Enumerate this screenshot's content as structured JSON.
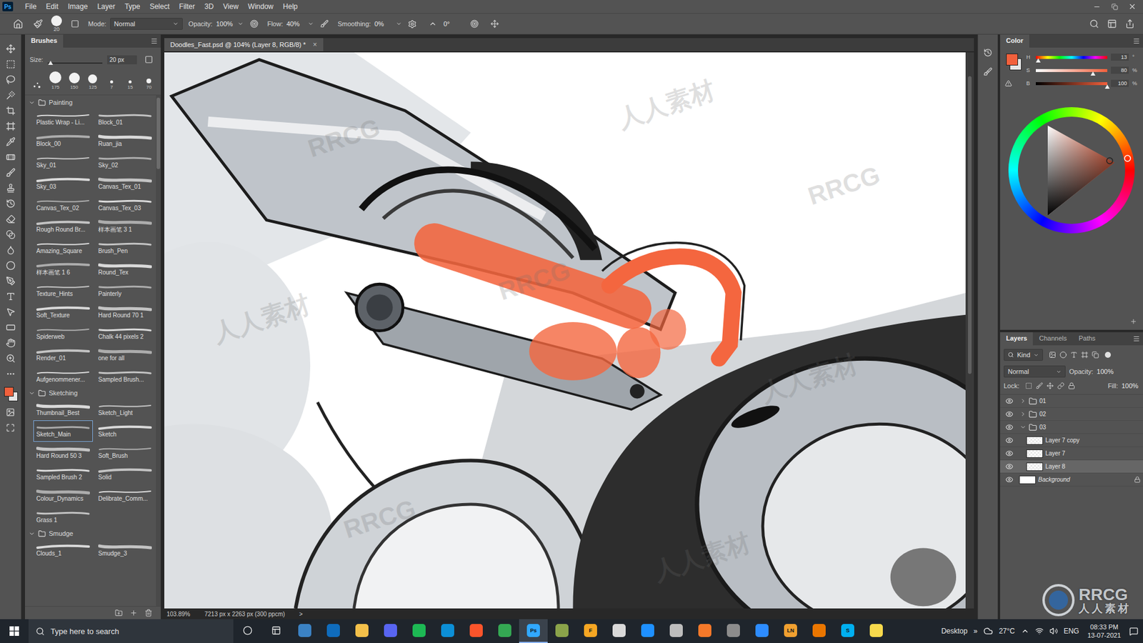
{
  "menu": {
    "logo": "Ps",
    "items": [
      "File",
      "Edit",
      "Image",
      "Layer",
      "Type",
      "Select",
      "Filter",
      "3D",
      "View",
      "Window",
      "Help"
    ]
  },
  "options_bar": {
    "brush_size": "20",
    "mode_label": "Mode:",
    "mode": "Normal",
    "opacity_label": "Opacity:",
    "opacity": "100%",
    "flow_label": "Flow:",
    "flow": "40%",
    "smoothing_label": "Smoothing:",
    "smoothing": "0%",
    "angle": "0°"
  },
  "tabs": [
    {
      "label": "Doodles_Fast.psd @ 104% (Layer 8, RGB/8) *",
      "selected": true,
      "close": "×"
    }
  ],
  "brushes_panel": {
    "title": "Brushes",
    "size_label": "Size:",
    "size": "20 px",
    "size_level": 0.05,
    "presets": [
      "175",
      "150",
      "125",
      "7",
      "15",
      "70"
    ],
    "groups": [
      {
        "name": "Painting",
        "expanded": true,
        "items": [
          {
            "label": "Plastic Wrap - Li...",
            "selected": false
          },
          {
            "label": "Block_01",
            "selected": false
          },
          {
            "label": "Block_00",
            "selected": false
          },
          {
            "label": "Ruan_jia",
            "selected": false
          },
          {
            "label": "Sky_01",
            "selected": false
          },
          {
            "label": "Sky_02",
            "selected": false
          },
          {
            "label": "Sky_03",
            "selected": false
          },
          {
            "label": "Canvas_Tex_01",
            "selected": false
          },
          {
            "label": "Canvas_Tex_02",
            "selected": false
          },
          {
            "label": "Canvas_Tex_03",
            "selected": false
          },
          {
            "label": "Rough Round Br...",
            "selected": false
          },
          {
            "label": "样本画笔 3 1",
            "selected": false
          },
          {
            "label": "Amazing_Square",
            "selected": false
          },
          {
            "label": "Brush_Pen",
            "selected": false
          },
          {
            "label": "样本画笔 1 6",
            "selected": false
          },
          {
            "label": "Round_Tex",
            "selected": false
          },
          {
            "label": "Texture_Hints",
            "selected": false
          },
          {
            "label": "Painterly",
            "selected": false
          },
          {
            "label": "Soft_Texture",
            "selected": false
          },
          {
            "label": "Hard Round 70 1",
            "selected": false
          },
          {
            "label": "Spiderweb",
            "selected": false
          },
          {
            "label": "Chalk 44 pixels 2",
            "selected": false
          },
          {
            "label": "Render_01",
            "selected": false
          },
          {
            "label": "one for all",
            "selected": false
          },
          {
            "label": "Aufgenommener...",
            "selected": false
          },
          {
            "label": "Sampled Brush...",
            "selected": false
          }
        ]
      },
      {
        "name": "Sketching",
        "expanded": true,
        "items": [
          {
            "label": "Thumbnail_Best",
            "selected": false
          },
          {
            "label": "Sketch_Light",
            "selected": false
          },
          {
            "label": "Sketch_Main",
            "selected": true
          },
          {
            "label": "Sketch",
            "selected": false
          },
          {
            "label": "Hard Round 50 3",
            "selected": false
          },
          {
            "label": "Soft_Brush",
            "selected": false
          },
          {
            "label": "Sampled Brush 2",
            "selected": false
          },
          {
            "label": "Solid",
            "selected": false
          },
          {
            "label": "Colour_Dynamics",
            "selected": false
          },
          {
            "label": "Delibrate_Comm...",
            "selected": false
          },
          {
            "label": "Grass 1",
            "selected": false
          }
        ]
      },
      {
        "name": "Smudge",
        "expanded": true,
        "items": [
          {
            "label": "Clouds_1",
            "selected": false
          },
          {
            "label": "Smudge_3",
            "selected": false
          }
        ]
      }
    ]
  },
  "status_bar": {
    "zoom": "103.89%",
    "info": "7213 px x 2263 px (300 ppcm)",
    "arrow": ">"
  },
  "color_panel": {
    "title": "Color",
    "foreground": "#f2603c",
    "background": "#e6e6e6",
    "channels": [
      {
        "name": "H",
        "kind": "hue",
        "value": "13",
        "unit": "°",
        "level": 0.036
      },
      {
        "name": "S",
        "kind": "saturation",
        "value": "80",
        "unit": "%",
        "level": 0.8
      },
      {
        "name": "B",
        "kind": "brightness",
        "value": "100",
        "unit": "%",
        "level": 1
      }
    ]
  },
  "layers_panel": {
    "tabs": [
      {
        "label": "Layers",
        "selected": true
      },
      {
        "label": "Channels",
        "selected": false
      },
      {
        "label": "Paths",
        "selected": false
      }
    ],
    "filter": "Kind",
    "blend_mode": "Normal",
    "opacity_label": "Opacity:",
    "opacity": "100%",
    "lock_label": "Lock:",
    "fill_label": "Fill:",
    "fill": "100%",
    "layers": [
      {
        "name": "01",
        "kind": "group",
        "visible": true,
        "expanded": false,
        "selected": false,
        "locked": false,
        "children": []
      },
      {
        "name": "02",
        "kind": "group",
        "visible": true,
        "expanded": false,
        "selected": false,
        "locked": false,
        "children": []
      },
      {
        "name": "03",
        "kind": "group",
        "visible": true,
        "expanded": true,
        "selected": false,
        "locked": false,
        "children": [
          {
            "name": "Layer 7 copy",
            "kind": "layer",
            "visible": true,
            "expanded": false,
            "selected": false,
            "locked": false,
            "children": []
          },
          {
            "name": "Layer 7",
            "kind": "layer",
            "visible": true,
            "expanded": false,
            "selected": false,
            "locked": false,
            "children": []
          },
          {
            "name": "Layer 8",
            "kind": "layer",
            "visible": true,
            "expanded": false,
            "selected": true,
            "locked": false,
            "children": []
          }
        ]
      },
      {
        "name": "Background",
        "kind": "background",
        "visible": true,
        "expanded": false,
        "selected": false,
        "locked": true,
        "children": []
      }
    ]
  },
  "taskbar": {
    "search_placeholder": "Type here to search",
    "desktop": "Desktop",
    "chevron": "»",
    "weather": "27°C",
    "language": "ENG",
    "time": "08:33 PM",
    "date": "13-07-2021",
    "apps": [
      {
        "label": "",
        "color": "#3b82c4",
        "active": false
      },
      {
        "label": "",
        "color": "#0f6cbd",
        "active": false
      },
      {
        "label": "",
        "color": "#f3c04a",
        "active": false
      },
      {
        "label": "",
        "color": "#5865f2",
        "active": false
      },
      {
        "label": "",
        "color": "#1db954",
        "active": false
      },
      {
        "label": "",
        "color": "#0c8fd7",
        "active": false
      },
      {
        "label": "",
        "color": "#fb542b",
        "active": false
      },
      {
        "label": "",
        "color": "#34a853",
        "active": false
      },
      {
        "label": "Ps",
        "color": "#31a8ff",
        "active": true
      },
      {
        "label": "",
        "color": "#8aa34a",
        "active": false
      },
      {
        "label": "F",
        "color": "#f5a623",
        "active": false
      },
      {
        "label": "",
        "color": "#d9d9d9",
        "active": false
      },
      {
        "label": "",
        "color": "#1e90ff",
        "active": false
      },
      {
        "label": "",
        "color": "#bdbdbd",
        "active": false
      },
      {
        "label": "",
        "color": "#f5792a",
        "active": false
      },
      {
        "label": "",
        "color": "#8c8c8c",
        "active": false
      },
      {
        "label": "",
        "color": "#2d8cff",
        "active": false
      },
      {
        "label": "LN",
        "color": "#f0a030",
        "active": false
      },
      {
        "label": "",
        "color": "#ea7600",
        "active": false
      },
      {
        "label": "S",
        "color": "#00aff0",
        "active": false
      },
      {
        "label": "",
        "color": "#f7d94c",
        "active": false
      }
    ]
  },
  "watermark": {
    "texts": [
      "RRCG",
      "人人素材"
    ]
  }
}
